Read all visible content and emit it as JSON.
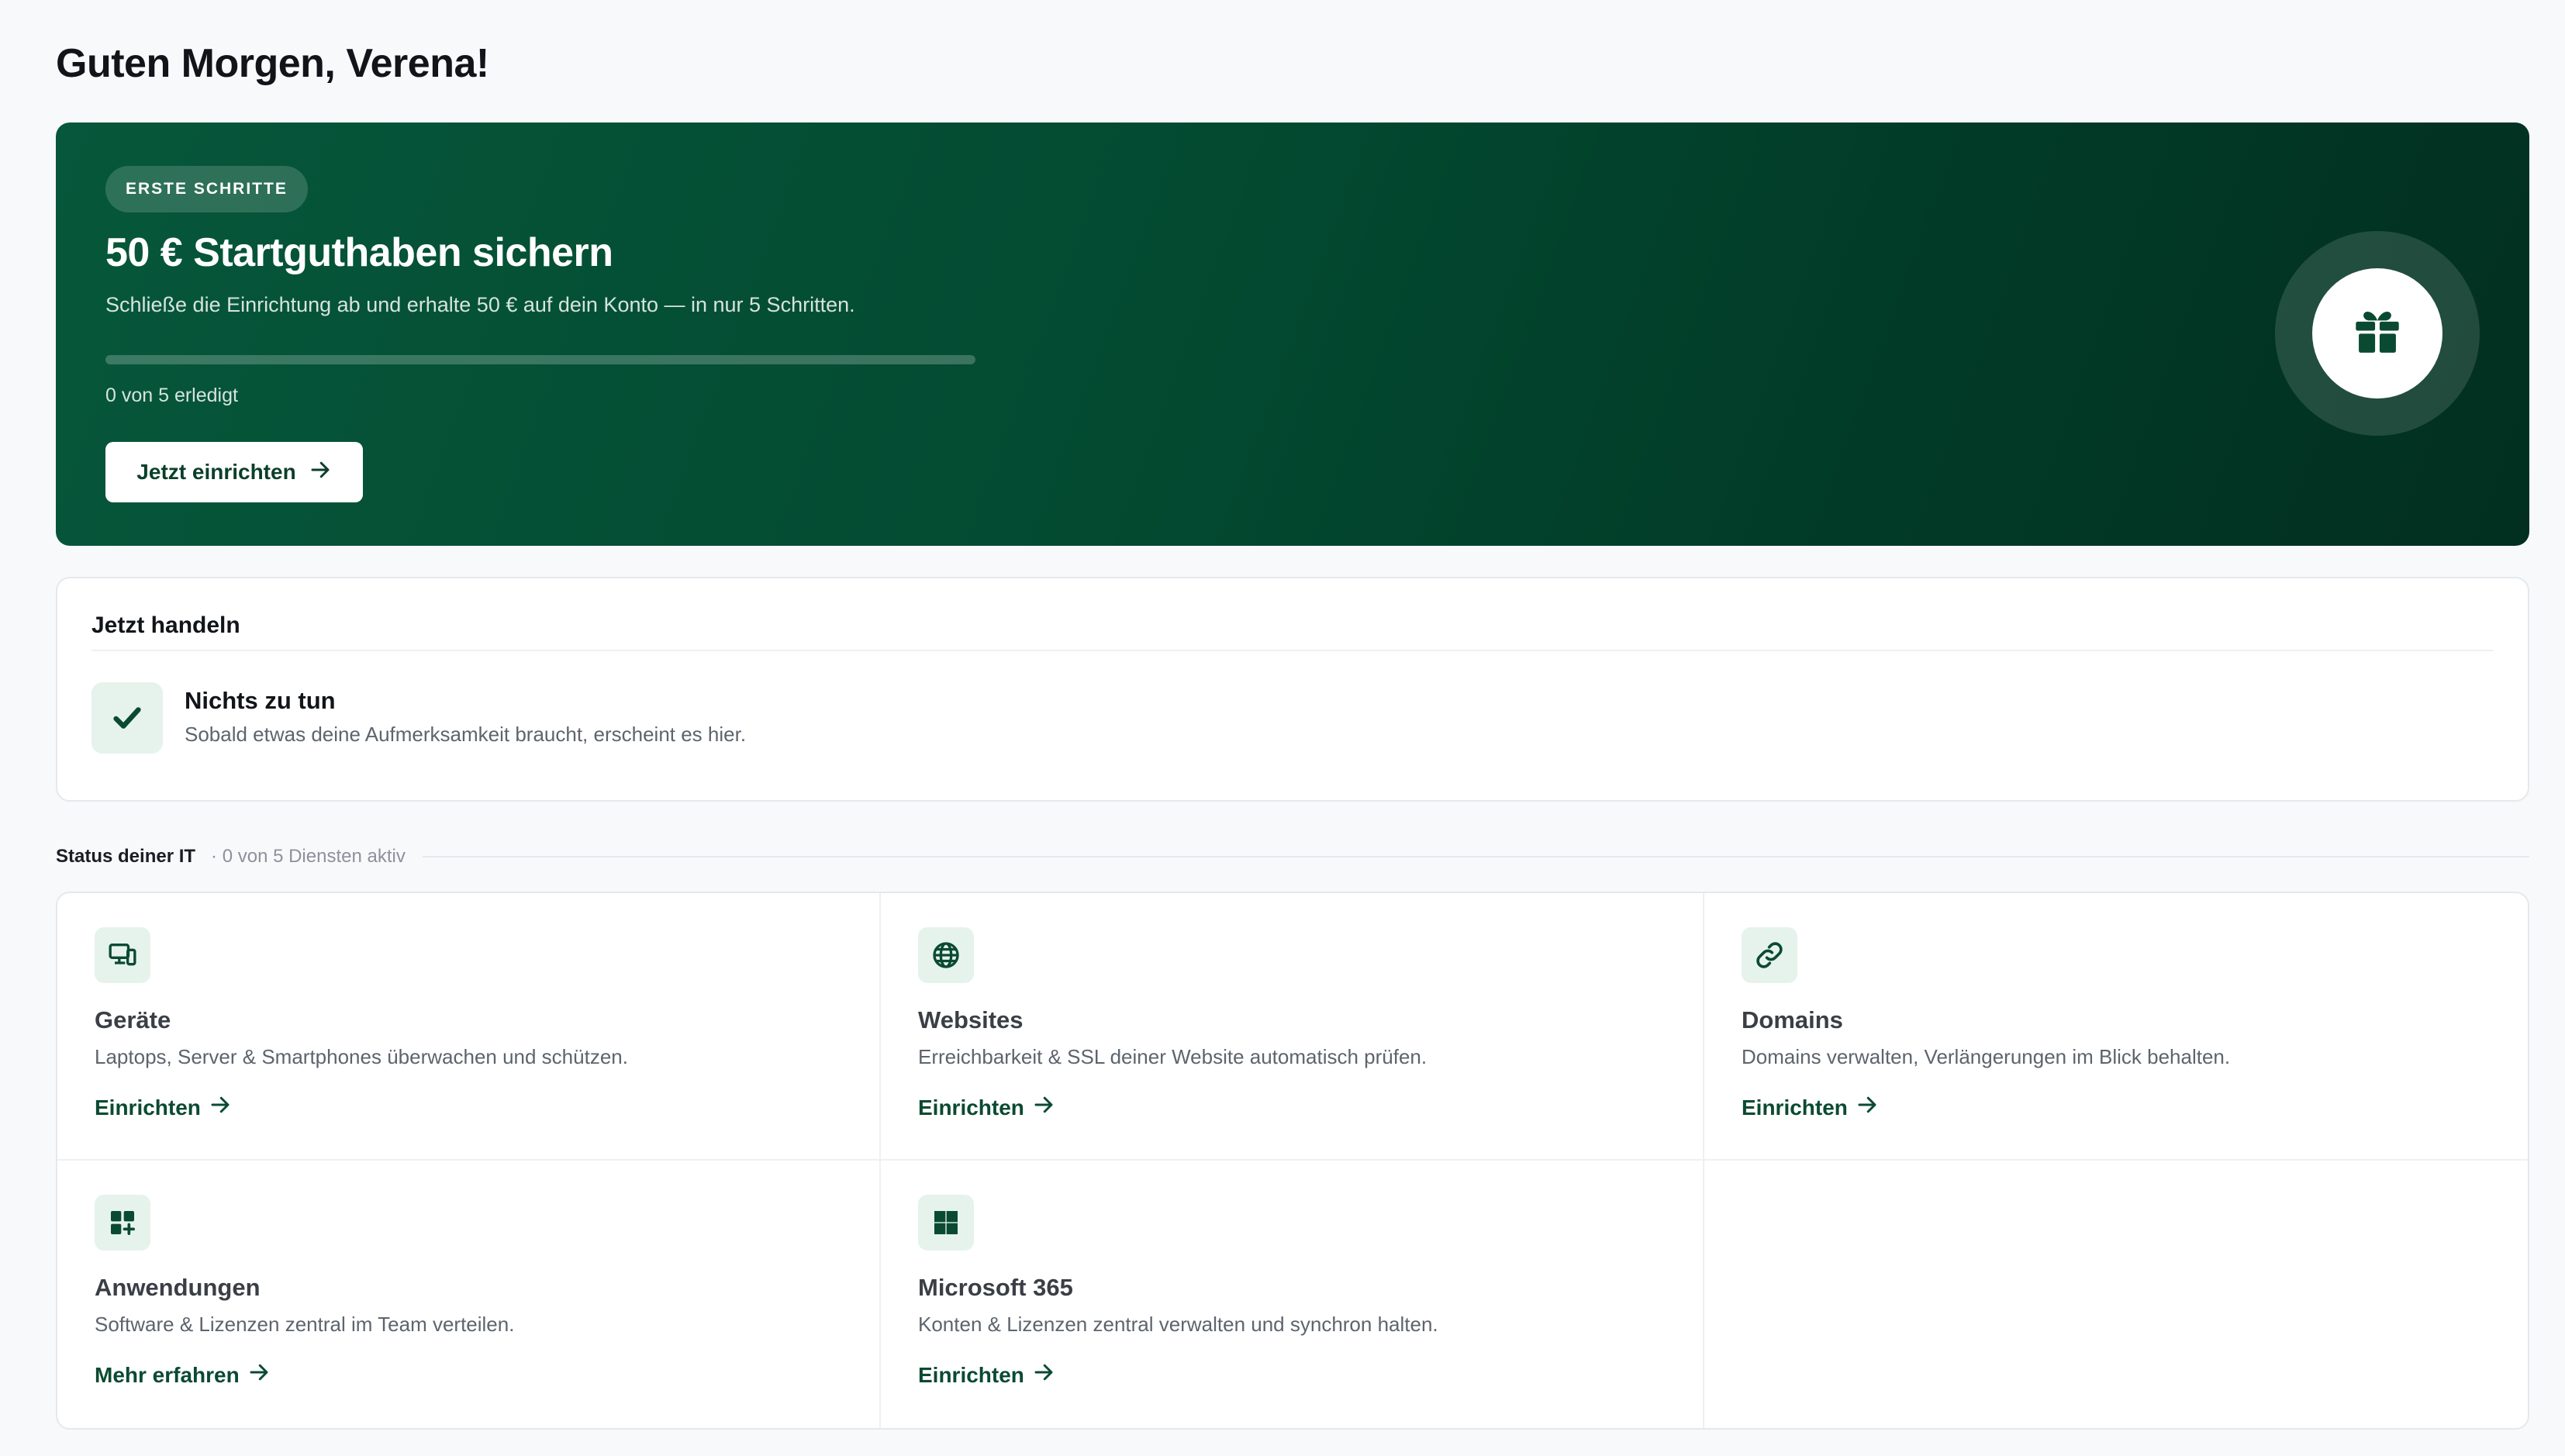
{
  "greeting": "Guten Morgen, Verena!",
  "hero": {
    "badge": "ERSTE SCHRITTE",
    "title": "50 € Startguthaben sichern",
    "subtitle": "Schließe die Einrichtung ab und erhalte 50 € auf dein Konto — in nur 5 Schritten.",
    "progress_fraction": 0,
    "progress_text": "0 von 5 erledigt",
    "button_label": "Jetzt einrichten",
    "button_icon": "arrow-right-icon",
    "illustration_icon": "gift-icon"
  },
  "action": {
    "title": "Jetzt handeln",
    "icon": "check-icon",
    "headline": "Nichts zu tun",
    "text": "Sobald etwas deine Aufmerksamkeit braucht, erscheint es hier."
  },
  "status": {
    "label": "Status deiner IT",
    "count": "· 0 von 5 Diensten aktiv"
  },
  "services": [
    {
      "icon": "devices-icon",
      "title": "Geräte",
      "description": "Laptops, Server & Smartphones überwachen und schützen.",
      "link": "Einrichten"
    },
    {
      "icon": "globe-icon",
      "title": "Websites",
      "description": "Erreichbarkeit & SSL deiner Website automatisch prüfen.",
      "link": "Einrichten"
    },
    {
      "icon": "link-icon",
      "title": "Domains",
      "description": "Domains verwalten, Verlängerungen im Blick behalten.",
      "link": "Einrichten"
    },
    {
      "icon": "apps-add-icon",
      "title": "Anwendungen",
      "description": "Software & Lizenzen zentral im Team verteilen.",
      "link": "Mehr erfahren"
    },
    {
      "icon": "windows-icon",
      "title": "Microsoft 365",
      "description": "Konten & Lizenzen zentral verwalten und synchron halten.",
      "link": "Einrichten"
    }
  ],
  "colors": {
    "brand_dark": "#034a31",
    "accent_green": "#0b4a32",
    "icon_bg": "#e6f3ec",
    "page_bg": "#f8f9fb"
  }
}
